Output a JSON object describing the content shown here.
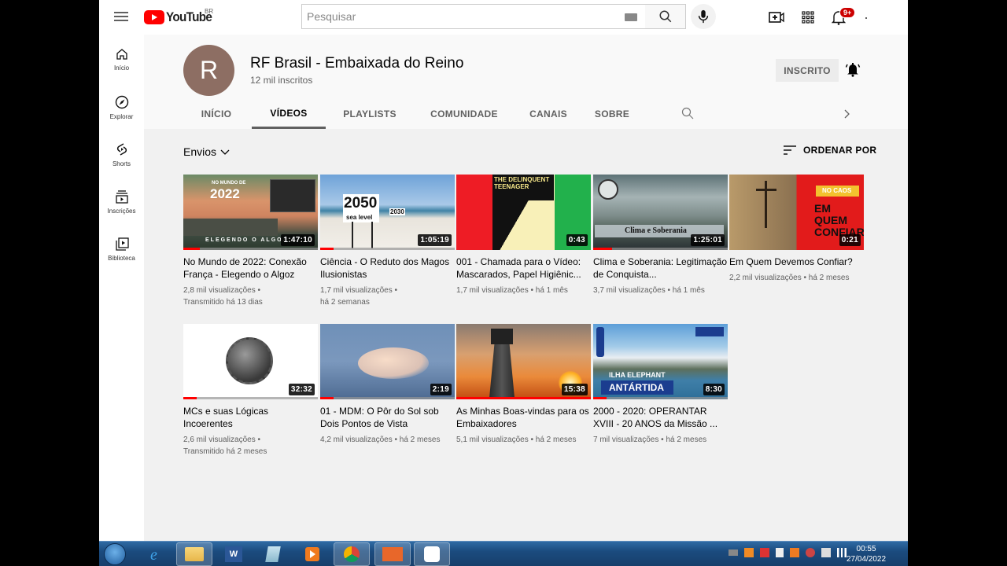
{
  "header": {
    "logo_text": "YouTube",
    "country_code": "BR",
    "search_placeholder": "Pesquisar",
    "notification_badge": "9+"
  },
  "sidebar": {
    "items": [
      {
        "label": "Início",
        "icon": "home-icon"
      },
      {
        "label": "Explorar",
        "icon": "compass-icon"
      },
      {
        "label": "Shorts",
        "icon": "shorts-icon"
      },
      {
        "label": "Inscrições",
        "icon": "subscriptions-icon"
      },
      {
        "label": "Biblioteca",
        "icon": "library-icon"
      }
    ]
  },
  "channel": {
    "avatar_letter": "R",
    "avatar_color": "#8d6e63",
    "name": "RF Brasil - Embaixada do Reino",
    "subscribers": "12 mil inscritos",
    "subscribed_label": "INSCRITO",
    "tabs": [
      {
        "label": "INÍCIO",
        "active": false
      },
      {
        "label": "VÍDEOS",
        "active": true
      },
      {
        "label": "PLAYLISTS",
        "active": false
      },
      {
        "label": "COMUNIDADE",
        "active": false
      },
      {
        "label": "CANAIS",
        "active": false
      },
      {
        "label": "SOBRE",
        "active": false
      }
    ]
  },
  "content": {
    "filter_label": "Envios",
    "sort_label": "ORDENAR POR",
    "videos": [
      {
        "title": "No Mundo de 2022: Conexão França - Elegendo o Algoz",
        "duration": "1:47:10",
        "views": "2,8 mil visualizações",
        "time": "Transmitido há 13 dias",
        "progress": 0.12
      },
      {
        "title": "Ciência - O Reduto dos Magos Ilusionistas",
        "duration": "1:05:19",
        "views": "1,7 mil visualizações",
        "time": "há 2 semanas",
        "progress": 0.1
      },
      {
        "title": "001 - Chamada para o Vídeo: Mascarados, Papel Higiênic...",
        "duration": "0:43",
        "views": "1,7 mil visualizações",
        "time": "há 1 mês",
        "progress": 0
      },
      {
        "title": "Clima e Soberania: Legitimação de Conquista...",
        "duration": "1:25:01",
        "views": "3,7 mil visualizações",
        "time": "há 1 mês",
        "progress": 0.14
      },
      {
        "title": "Em Quem Devemos Confiar?",
        "duration": "0:21",
        "views": "2,2 mil visualizações",
        "time": "há 2 meses",
        "progress": 0
      },
      {
        "title": "MCs e suas Lógicas Incoerentes",
        "duration": "32:32",
        "views": "2,6 mil visualizações",
        "time": "Transmitido há 2 meses",
        "progress": 0.1
      },
      {
        "title": "01 - MDM: O Pôr do Sol sob Dois Pontos de Vista",
        "duration": "2:19",
        "views": "4,2 mil visualizações",
        "time": "há 2 meses",
        "progress": 0.1
      },
      {
        "title": "As Minhas Boas-vindas para os Embaixadores",
        "duration": "15:38",
        "views": "5,1 mil visualizações",
        "time": "há 2 meses",
        "progress": 1.0
      },
      {
        "title": "2000 - 2020: OPERANTAR XVIII - 20 ANOS da Missão ...",
        "duration": "8:30",
        "views": "7 mil visualizações",
        "time": "há 2 meses",
        "progress": 0.1
      }
    ],
    "thumb_texts": {
      "v1_top": "NO MUNDO DE",
      "v1_year": "2022",
      "v1_bottom": "ELEGENDO O ALGOZ",
      "v2_sign": "2050",
      "v2_sub": "sea level",
      "v2_small": "2030",
      "v3_top": "THE DELINQUENT TEENAGER",
      "v4_caption": "Clima e Soberania",
      "v5_tag": "NO CAOS",
      "v5_q": "EM QUEM CONFIAR?",
      "v9_top": "ILHA ELEPHANT",
      "v9_bottom": "ANTÁRTIDA"
    }
  },
  "taskbar": {
    "time": "00:55",
    "date": "27/04/2022"
  }
}
